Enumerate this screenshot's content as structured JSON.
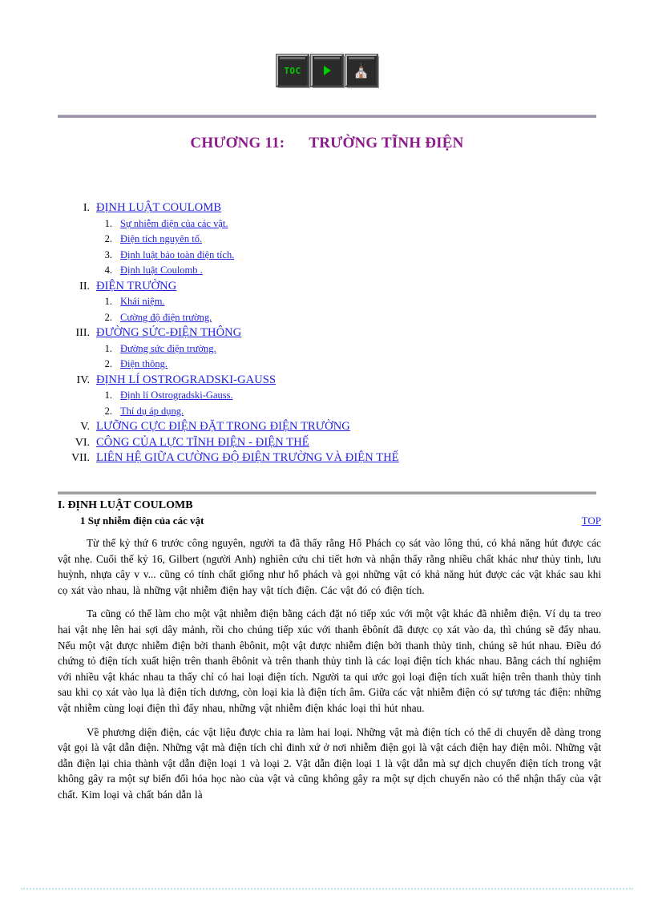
{
  "navbar": {
    "buttons": [
      {
        "name": "toc-button",
        "label": "TOC",
        "icon": "toc-text"
      },
      {
        "name": "next-button",
        "label": "",
        "icon": "play-triangle-icon"
      },
      {
        "name": "home-button",
        "label": "⌂",
        "icon": "home-icon"
      }
    ]
  },
  "title": {
    "chapter": "CHƯƠNG 11:",
    "name": "TRƯỜNG TĨNH ĐIỆN"
  },
  "toc": [
    {
      "numeral": "I.",
      "label": "ĐỊNH LUẬT COULOMB",
      "children": [
        {
          "numeral": "1.",
          "label": "Sự nhiễm  điện của các vật."
        },
        {
          "numeral": "2.",
          "label": "Điện tích nguyên tố."
        },
        {
          "numeral": "3.",
          "label": "Định luật bảo toàn điện tích."
        },
        {
          "numeral": "4.",
          "label": "Định luật Coulomb ."
        }
      ]
    },
    {
      "numeral": "II.",
      "label": "ĐIỆN TRƯỜNG",
      "children": [
        {
          "numeral": "1.",
          "label": "Khái niệm."
        },
        {
          "numeral": "2.",
          "label": "Cường độ điện trường."
        }
      ]
    },
    {
      "numeral": "III.",
      "label": "ĐƯỜNG SỨC-ĐIỆN THÔNG",
      "children": [
        {
          "numeral": "1.",
          "label": "Đường sức điện trường."
        },
        {
          "numeral": "2.",
          "label": "Điện thông."
        }
      ]
    },
    {
      "numeral": "IV.",
      "label": "ĐỊNH LÍ OSTROGRADSKI-GAUSS",
      "children": [
        {
          "numeral": "1.",
          "label": "Định lí Ostrogradski-Gauss."
        },
        {
          "numeral": "2.",
          "label": "Thí dụ áp dụng."
        }
      ]
    },
    {
      "numeral": "V.",
      "label": "LƯỠNG CỰC ĐIỆN ĐẶT TRONG ĐIỆN TRƯỜNG",
      "children": []
    },
    {
      "numeral": "VI.",
      "label": "CÔNG CỦA LỰC TĨNH ĐIỆN - ĐIỆN THẾ",
      "children": []
    },
    {
      "numeral": "VII.",
      "label": "LIÊN HỆ GIỮA CƯỜNG ĐỘ ĐIỆN TRƯỜNG VÀ ĐIỆN THẾ",
      "children": []
    }
  ],
  "section": {
    "heading": "I. ĐỊNH LUẬT COULOMB",
    "sub_heading": "1 Sự nhiễm  điện của các vật",
    "top_link": "TOP",
    "paragraphs": [
      "Từ thế kỷ thứ 6  trước công nguyên,  người  ta đã thấy rằng Hổ Phách cọ sát vào lông  thú, có khả năng hút được các vật nhẹ. Cuối thế kỷ 16, Gilbert (người Anh) nghiên  cứu chi tiết hơn và nhận thấy rằng nhiều  chất khác như thủy tinh, lưu huỳnh, nhựa cây v v... cũng có tính chất giống  như hổ phách và gọi những vật có khả năng hút  được các vật khác sau khi  cọ xát vào nhau, là những vật nhiễm  điện hay vật tích điện. Các vật đó có điện tích.",
      "Ta cũng  có thể làm cho một vật nhiễm  điện bằng cách đặt nó  tiếp xúc với một vật khác đã nhiễm điện. Ví dụ ta treo hai vật nhẹ lên hai sợi dây mảnh, rồi cho chúng  tiếp xúc với thanh  êbônít  đã được cọ xát vào da, thì  chúng  sẽ đẩy nhau. Nếu một vật được nhiễm  điện bởi thanh  êbônit, một vật được nhiễm điện bởi thanh thủy tinh,  chúng  sẽ hút nhau. Điều đó chứng tỏ điện tích  xuất hiện trên thanh êbônit và trên thanh thủy tinh là các loại điện tích khác nhau. Bằng cách thí nghiệm  với nhiều  vật khác nhau ta thấy chỉ có hai loại điện tích. Người ta qui ước gọi loại điện tích xuất hiện trên  thanh thủy tinh  sau khi cọ xát vào lụa là điện tích dương, còn loại kia là điện tích âm. Giữa các vật nhiễm  điện  có sự tương tác điện: những vật nhiễm  cùng loại điện thì đẩy nhau, những vật nhiễm  điện khác loại thì hút nhau.",
      "Về phương diện điện, các vật liệu  được chia ra làm hai loại.  Những vật mà điện tích có thể di chuyển dễ dàng trong vật gọi là vật dẫn điện. Những vật mà điện tích chỉ đinh xứ  ở nơi nhiễm  điện gọi là vật cách điện hay điện môi. Những vật dẫn điện lại chia thành vật dẫn điện loại 1 và loại 2. Vật dẫn điện loại 1 là vật dẫn mà sự dịch chuyển  điện tích trong vật không gây ra  một sự biến đổi hóa học nào của vật và cũng  không gây ra  một sự dịch chuyển  nào có thể nhận  thấy của vật chất. Kim loại  và chất bán dẫn là"
    ]
  }
}
